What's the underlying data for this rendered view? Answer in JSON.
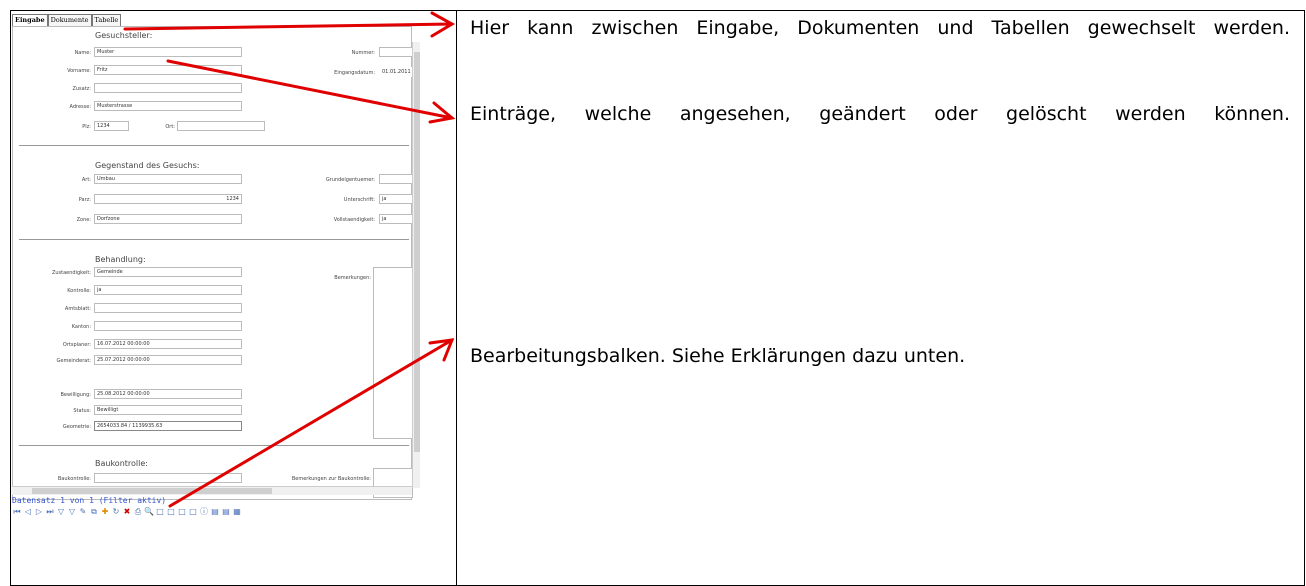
{
  "tabs": [
    "Eingabe",
    "Dokumente",
    "Tabelle"
  ],
  "sections": {
    "gesuchsteller": {
      "title": "Gesuchsteller:",
      "name_label": "Name:",
      "name": "Muster",
      "vorname_label": "Vorname:",
      "vorname": "Fritz",
      "zusatz_label": "Zusatz:",
      "zusatz": "",
      "adresse_label": "Adresse:",
      "adresse": "Musterstrasse",
      "plz_label": "Plz:",
      "plz": "1234",
      "ort_label": "Ort:",
      "ort": "",
      "nummer_label": "Nummer:",
      "nummer": "",
      "eingangsdatum_label": "Eingangsdatum:",
      "eingangsdatum": "01.01.2011 0"
    },
    "gegenstand": {
      "title": "Gegenstand des Gesuchs:",
      "art_label": "Art:",
      "art": "Umbau",
      "parz_label": "Parz:",
      "parz": "1234",
      "zone_label": "Zone:",
      "zone": "Dorfzone",
      "grund_label": "Grundeigentuemer:",
      "grund": "",
      "unterschrift_label": "Unterschrift:",
      "unterschrift": "ja",
      "vollst_label": "Vollstaendigkeit:",
      "vollst": "ja"
    },
    "behandlung": {
      "title": "Behandlung:",
      "zust_label": "Zustaendigkeit:",
      "zust": "Gemeinde",
      "kontrolle_label": "Kontrolle:",
      "kontrolle": "ja",
      "amtsblatt_label": "Amtsblatt:",
      "amtsblatt": "",
      "kanton_label": "Kanton:",
      "kanton": "",
      "ortsplaner_label": "Ortsplaner:",
      "ortsplaner": "16.07.2012 00:00:00",
      "gemeinderat_label": "Gemeinderat:",
      "gemeinderat": "25.07.2012 00:00:00",
      "bewilligung_label": "Bewilligung:",
      "bewilligung": "25.08.2012 00:00:00",
      "status_label": "Status:",
      "status": "Bewilligt",
      "geometrie_label": "Geometrie:",
      "geometrie": "2654033.84 / 1139935.63",
      "bemerkungen_label": "Bemerkungen:"
    },
    "baukontrolle": {
      "title": "Baukontrolle:",
      "bk_label": "Baukontrolle:",
      "bk": "",
      "bem_label": "Bemerkungen zur Baukontrolle:"
    }
  },
  "status_line": "Datensatz 1 von 1 (Filter aktiv)",
  "toolbar_icons": [
    "first-record-icon",
    "prev-record-icon",
    "next-record-icon",
    "last-record-icon",
    "filter-icon",
    "filter-clear-icon",
    "edit-icon",
    "copy-icon",
    "new-record-icon",
    "refresh-icon",
    "delete-icon",
    "print-icon",
    "search-icon",
    "view1-icon",
    "view2-icon",
    "view3-icon",
    "view4-icon",
    "info-icon",
    "export-icon",
    "import-icon",
    "settings-icon"
  ],
  "toolbar_glyphs": [
    "⏮",
    "◁",
    "▷",
    "⏭",
    "▽",
    "▽",
    "✎",
    "⧉",
    "✚",
    "↻",
    "✖",
    "⎙",
    "🔍",
    "□",
    "□",
    "□",
    "□",
    "ⓘ",
    "▤",
    "▤",
    "▦"
  ],
  "annotations": {
    "tabs_note": "Hier kann zwischen Eingabe, Dokumenten und Tabellen gewechselt werden.",
    "entries_note": "Einträge, welche angesehen, geändert oder gelöscht werden können.",
    "toolbar_note": "Bearbeitungsbalken. Siehe Erklärungen dazu unten."
  },
  "colors": {
    "arrow": "#e00000",
    "status_text": "#3355cc"
  }
}
